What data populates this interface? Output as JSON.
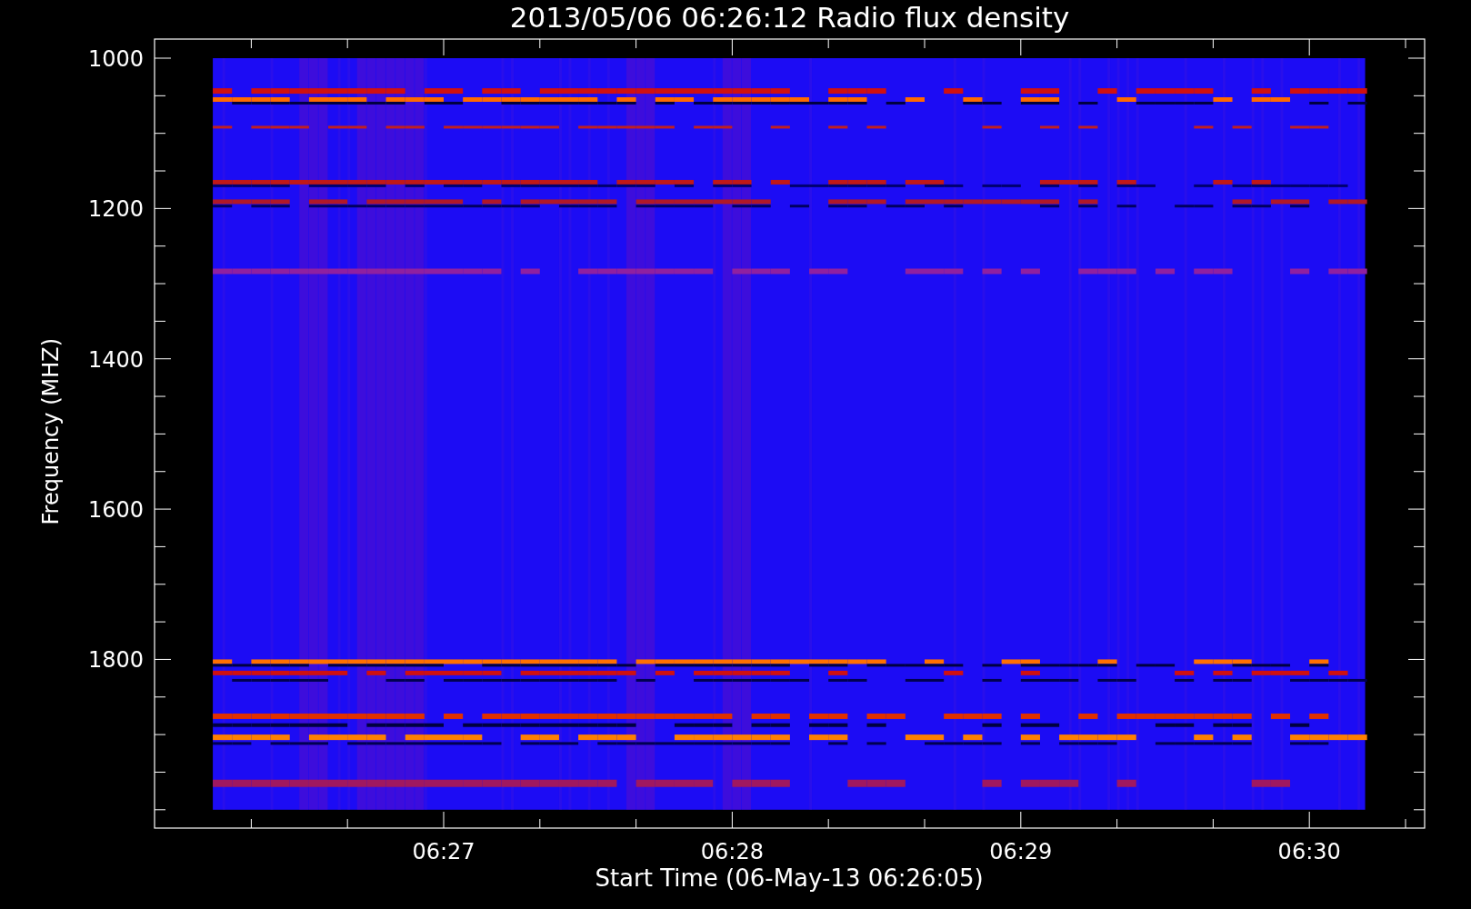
{
  "plot": {
    "title": "2013/05/06 06:26:12 Radio flux density",
    "ylabel": "Frequency (MHZ)",
    "xlabel": "Start Time (06-May-13 06:26:05)",
    "ytick_labels": [
      "1000",
      "1200",
      "1400",
      "1600",
      "1800"
    ],
    "xtick_labels": [
      "06:27",
      "06:28",
      "06:29",
      "06:30"
    ]
  }
}
